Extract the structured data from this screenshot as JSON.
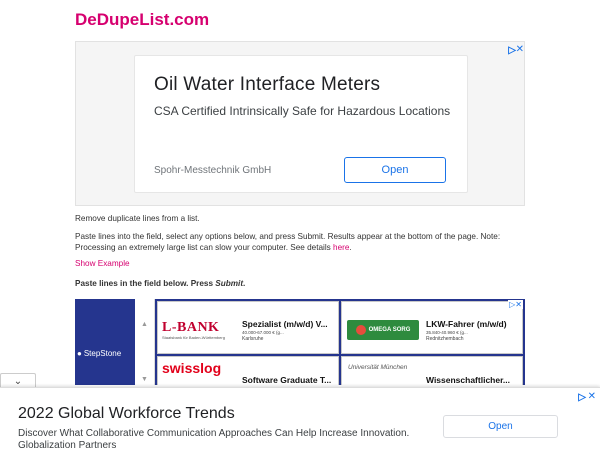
{
  "site": {
    "title": "DeDupeList.com"
  },
  "top_ad": {
    "headline": "Oil Water Interface Meters",
    "subline": "CSA Certified Intrinsically Safe for Hazardous Locations",
    "advertiser": "Spohr-Messtechnik GmbH",
    "button": "Open",
    "adchoices_icon": "play-triangle",
    "close_icon": "x"
  },
  "content": {
    "intro": "Remove duplicate lines from a list.",
    "instructions": "Paste lines into the field, select any options below, and press Submit. Results appear at the bottom of the page. Note: Processing an extremely large list can slow your computer. See details ",
    "details_link": "here",
    "instructions_end": ".",
    "show_example": "Show Example",
    "paste_prompt": "Paste lines in the field below. Press ",
    "paste_prompt_em": "Submit",
    "paste_prompt_end": "."
  },
  "job_ad": {
    "brand": "StepStone",
    "jobs": [
      {
        "company": "L-BANK",
        "company_sub": "Staatsbank für Baden-Württemberg",
        "title": "Spezialist (m/w/d) V...",
        "salary": "40.000-67.000 € (g...",
        "place": "Karlsruhe"
      },
      {
        "company": "OMEGA SORG",
        "title": "LKW-Fahrer (m/w/d)",
        "salary": "35.840-40.960 € (g...",
        "place": "Rednitzhembach"
      },
      {
        "company": "swisslog",
        "title": "Software Graduate T...",
        "salary": "",
        "place": ""
      },
      {
        "company": "Universität München",
        "title": "Wissenschaftlicher...",
        "salary": "",
        "place": ""
      }
    ]
  },
  "anchor_ad": {
    "headline": "2022 Global Workforce Trends",
    "desc": "Discover What Collaborative Communication Approaches Can Help Increase Innovation. Globalization Partners",
    "button": "Open",
    "collapse_icon": "chevron-down"
  },
  "colors": {
    "brand": "#d6006f",
    "ad_link": "#1a73e8",
    "stepstone": "#25358e"
  }
}
